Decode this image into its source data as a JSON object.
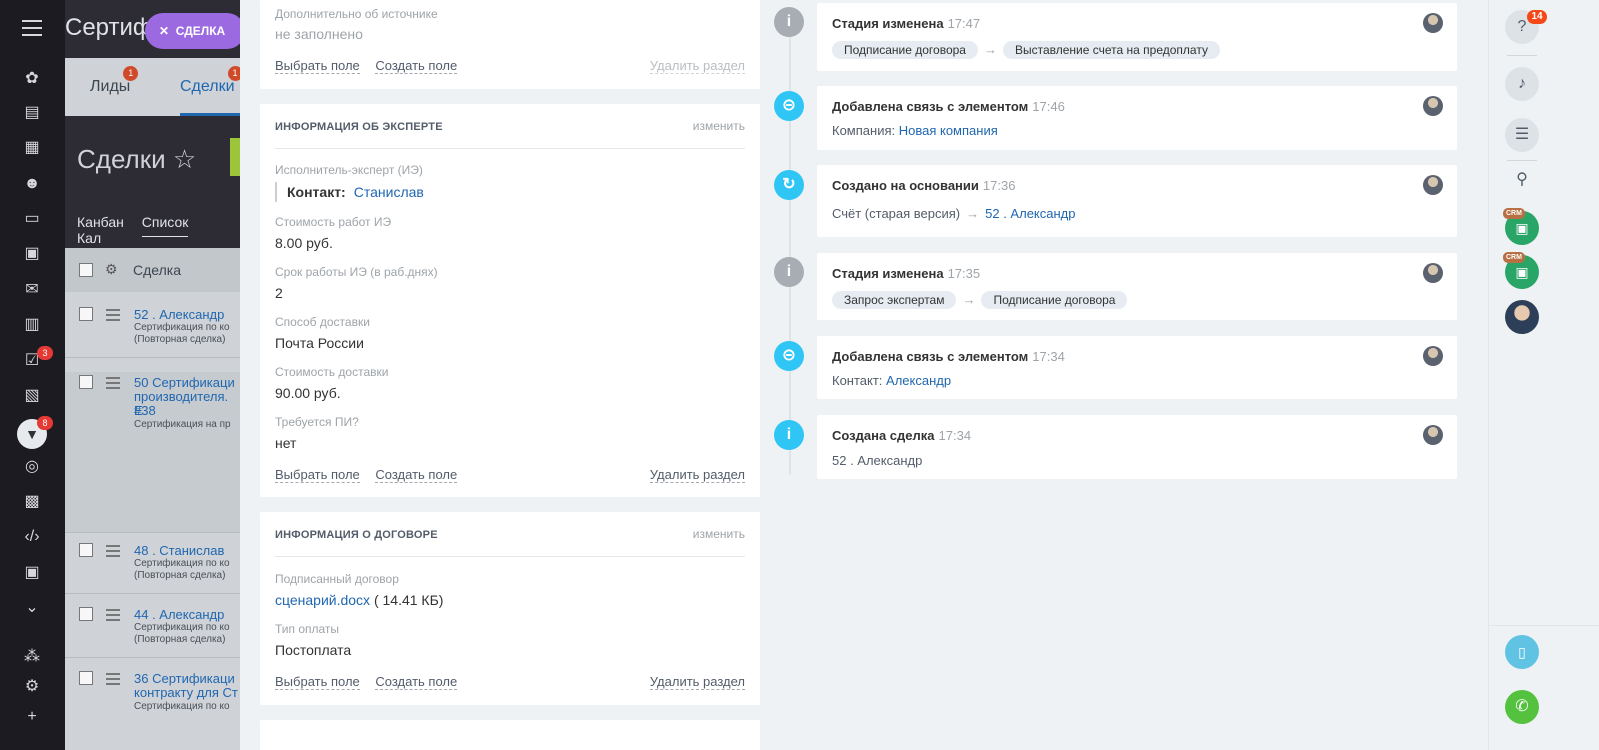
{
  "bg": {
    "app_title": "Сертиф",
    "deal_pill": "СДЕЛКА",
    "tabs": [
      {
        "label": "Лиды",
        "badge": "1"
      },
      {
        "label": "Сделки",
        "badge": "1"
      }
    ],
    "section_title": "Сделки",
    "views": [
      "Канбан",
      "Список",
      "Кал"
    ],
    "list_header": "Сделка",
    "rows": [
      {
        "title": "52 . Александр",
        "sub1": "Сертификация по ко",
        "sub2": "(Повторная сделка)"
      },
      {
        "title": "50 Сертификаци",
        "title2": "производителя. Е",
        "title3": "#38",
        "sub1": "Сертификация на пр"
      },
      {
        "title": "48 . Станислав",
        "sub1": "Сертификация по ко",
        "sub2": "(Повторная сделка)"
      },
      {
        "title": "44 . Александр",
        "sub1": "Сертификация по ко",
        "sub2": "(Повторная сделка)"
      },
      {
        "title": "36 Сертификаци",
        "title2": "контракту для Ст",
        "sub1": "Сертификация по ко"
      }
    ],
    "left_badges": {
      "tasks": "3",
      "filter": "8"
    }
  },
  "source_card": {
    "label": "Дополнительно об источнике",
    "value": "не заполнено",
    "select_field": "Выбрать поле",
    "create_field": "Создать поле",
    "delete_section": "Удалить раздел"
  },
  "expert_card": {
    "title": "ИНФОРМАЦИЯ ОБ ЭКСПЕРТЕ",
    "edit": "изменить",
    "executor_label": "Исполнитель-эксперт (ИЭ)",
    "contact_label": "Контакт:",
    "contact_value": "Станислав",
    "cost_label": "Стоимость работ ИЭ",
    "cost_value": "8.00 руб.",
    "term_label": "Срок работы ИЭ (в раб.днях)",
    "term_value": "2",
    "delivery_label": "Способ доставки",
    "delivery_value": "Почта России",
    "delivery_cost_label": "Стоимость доставки",
    "delivery_cost_value": "90.00 руб.",
    "pi_label": "Требуется ПИ?",
    "pi_value": "нет",
    "select_field": "Выбрать поле",
    "create_field": "Создать поле",
    "delete_section": "Удалить раздел"
  },
  "contract_card": {
    "title": "ИНФОРМАЦИЯ О ДОГОВОРЕ",
    "edit": "изменить",
    "signed_label": "Подписанный договор",
    "file_name": "сценарий.docx",
    "file_size": "( 14.41 КБ)",
    "payment_label": "Тип оплаты",
    "payment_value": "Постоплата",
    "select_field": "Выбрать поле",
    "create_field": "Создать поле",
    "delete_section": "Удалить раздел"
  },
  "timeline": [
    {
      "title": "Стадия изменена",
      "time": "17:47",
      "from": "Подписание договора",
      "to": "Выставление счета на предоплату"
    },
    {
      "title": "Добавлена связь с элементом",
      "time": "17:46",
      "prefix": "Компания:",
      "link": "Новая компания"
    },
    {
      "title": "Создано на основании",
      "time": "17:36",
      "prefix": "Счёт (старая версия)",
      "link": "52 . Александр"
    },
    {
      "title": "Стадия изменена",
      "time": "17:35",
      "from": "Запрос экспертам",
      "to": "Подписание договора"
    },
    {
      "title": "Добавлена связь с элементом",
      "time": "17:34",
      "prefix": "Контакт:",
      "link": "Александр"
    },
    {
      "title": "Создана сделка",
      "time": "17:34",
      "prefix": "52 . Александр"
    }
  ],
  "rail": {
    "help_badge": "14",
    "crm_tag": "CRM"
  }
}
